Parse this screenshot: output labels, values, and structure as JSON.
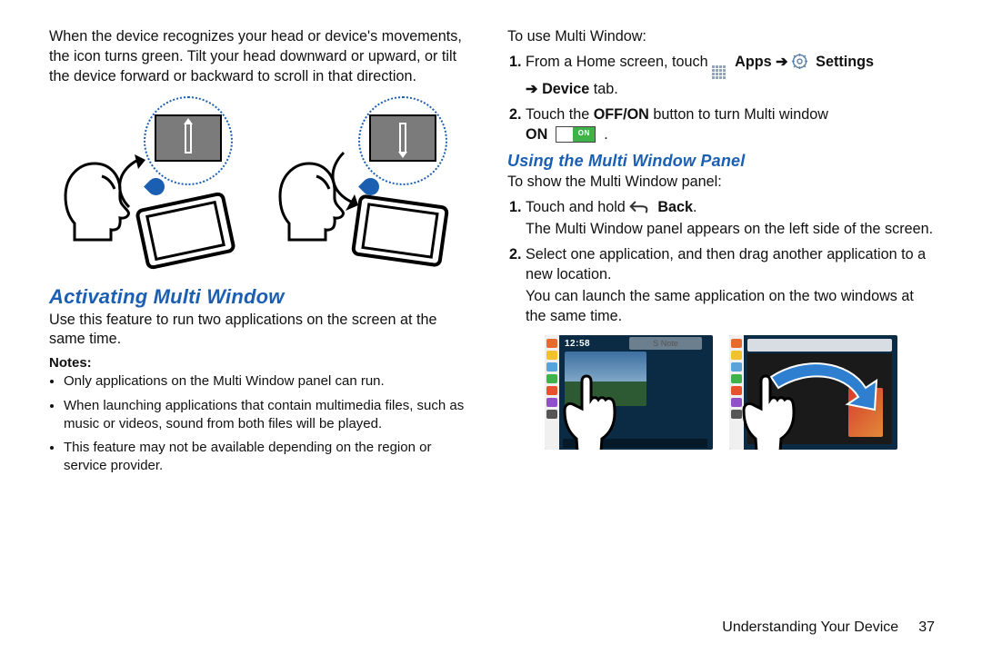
{
  "left": {
    "intro": "When the device recognizes your head or device's movements, the icon turns green. Tilt your head downward or upward, or tilt the device forward or backward to scroll in that direction.",
    "h2": "Activating Multi Window",
    "use": "Use this feature to run two applications on the screen at the same time.",
    "notes_label": "Notes:",
    "notes": [
      "Only applications on the Multi Window panel can run.",
      "When launching applications that contain multimedia files, such as music or videos, sound from both files will be played.",
      "This feature may not be available depending on the region or service provider."
    ]
  },
  "right": {
    "intro": "To use Multi Window:",
    "s1a": "From a Home screen, touch ",
    "apps": "Apps",
    "settings": "Settings",
    "device": "Device",
    "tabword": " tab.",
    "s2a": "Touch the ",
    "offon": "OFF/ON",
    "s2b": " button to turn Multi window ",
    "on": "ON",
    "toggle_label": "ON",
    "h3": "Using the Multi Window Panel",
    "show": "To show the Multi Window panel:",
    "p1a": "Touch and hold ",
    "back": "Back",
    "p1b": "The Multi Window panel appears on the left side of the screen.",
    "p2a": "Select one application, and then drag another application to a new location.",
    "p2b": "You can launch the same application on the two windows at the same time.",
    "clock": "12:58",
    "note": "S Note"
  },
  "footer": {
    "section": "Understanding Your Device",
    "page": "37"
  }
}
